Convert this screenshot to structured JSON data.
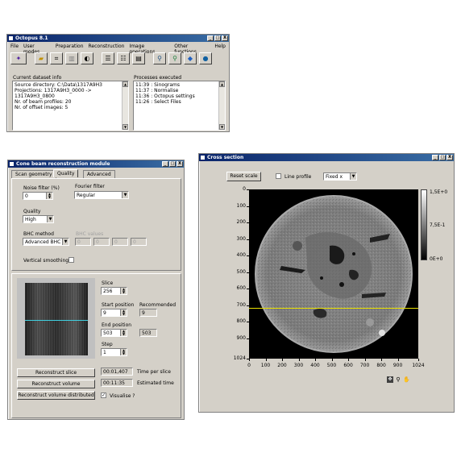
{
  "octopus": {
    "title": "Octopus 8.1",
    "window_buttons": [
      "_",
      "□",
      "X"
    ],
    "menu": [
      "File",
      "User modes",
      "Preparation",
      "Reconstruction",
      "Image operations",
      "Other functions",
      "Help"
    ],
    "toolbar_icons": [
      "wizard-icon",
      "open-folder-icon",
      "crop-icon",
      "columns-icon",
      "palette-icon",
      "list-icon",
      "list2-icon",
      "list3-icon",
      "magnify-icon",
      "magnify2-icon",
      "tag-icon",
      "globe-icon"
    ],
    "dataset_info_label": "Current dataset info",
    "dataset_info": [
      "Source directory: C:\\Data\\1317A9H3",
      "Projections: 1317A9H3_0000 ->",
      "1317A9H3_0800",
      "Nr. of beam profiles: 20",
      "Nr. of offset images: 5"
    ],
    "processes_label": "Processes executed",
    "processes": [
      "11:39 : Sinograms",
      "11:37 : Normalise",
      "11:36 : Octopus settings",
      "11:26 : Select Files"
    ]
  },
  "cone": {
    "title": "Cone beam reconstruction module",
    "tabs": [
      "Scan geometry",
      "Quality",
      "Advanced"
    ],
    "noise_filter_label": "Noise filter (%)",
    "noise_filter_value": "0",
    "fourier_filter_label": "Fourier filter",
    "fourier_filter_value": "Regular",
    "quality_label": "Quality",
    "quality_value": "High",
    "bhc_method_label": "BHC method",
    "bhc_method_value": "Advanced BHC",
    "bhc_values_label": "BHC values",
    "bhc_values": [
      "0",
      "0",
      "0",
      "0"
    ],
    "vertical_smoothing_label": "Vertical smoothing",
    "slice_label": "Slice",
    "slice_value": "256",
    "start_position_label": "Start position",
    "start_position_value": "9",
    "recommended_label": "Recommended",
    "recommended_start": "9",
    "end_position_label": "End position",
    "end_position_value": "503",
    "recommended_end": "503",
    "step_label": "Step",
    "step_value": "1",
    "reconstruct_slice": "Reconstruct slice",
    "reconstruct_volume": "Reconstruct volume",
    "reconstruct_volume_distributed": "Reconstruct volume distributed",
    "time_per_slice_value": "00:01,407",
    "time_per_slice_label": "Time per slice",
    "estimated_time_value": "00:11:35",
    "estimated_time_label": "Estimated time",
    "visualise_label": "Visualise ?",
    "visualise_checked": true
  },
  "cross": {
    "title": "Cross section",
    "reset_scale": "Reset scale",
    "line_profile_label": "Line profile",
    "fixed_value": "Fixed x",
    "y_ticks": [
      "0",
      "100",
      "200",
      "300",
      "400",
      "500",
      "600",
      "700",
      "800",
      "900",
      "1024"
    ],
    "x_ticks": [
      "0",
      "100",
      "200",
      "300",
      "400",
      "500",
      "600",
      "700",
      "800",
      "900",
      "1024"
    ],
    "colorbar_labels": [
      "1,5E+0",
      "7,5E-1",
      "0E+0"
    ],
    "line_y_value": 715,
    "line_color": "#e8e000"
  }
}
